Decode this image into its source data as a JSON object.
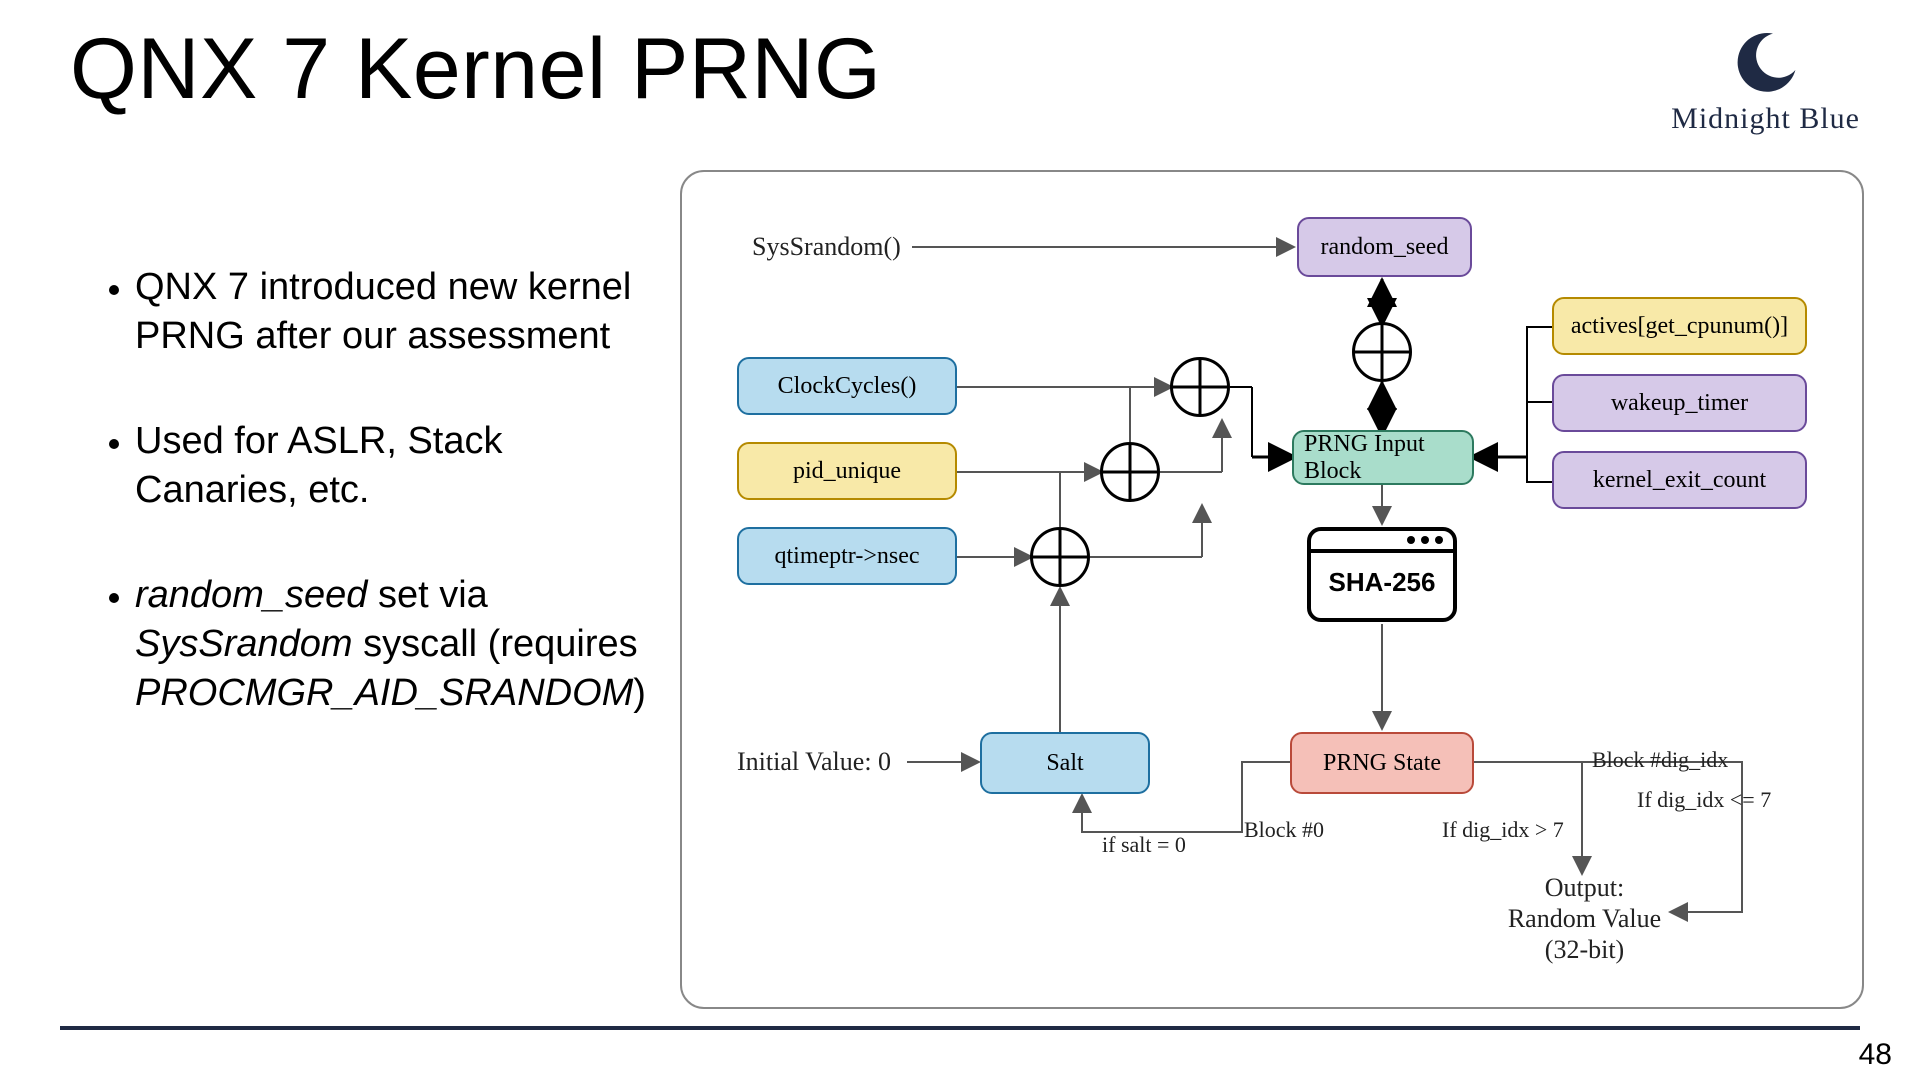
{
  "title": "QNX 7 Kernel PRNG",
  "logo_text": "Midnight Blue",
  "page_number": "48",
  "bullets": {
    "b1": "QNX 7 introduced new kernel PRNG after our assessment",
    "b2": "Used for ASLR, Stack Canaries, etc.",
    "b3_pre": "",
    "b3_rs": "random_seed",
    "b3_mid": " set via ",
    "b3_sys": "SysSrandom",
    "b3_post": " syscall (requires ",
    "b3_priv": "PROCMGR_AID_SRANDOM",
    "b3_end": ")"
  },
  "diagram": {
    "syssrandom": "SysSrandom()",
    "random_seed": "random_seed",
    "clockcycles": "ClockCycles()",
    "pid_unique": "pid_unique",
    "qtimeptr": "qtimeptr->nsec",
    "initial_value": "Initial Value: 0",
    "salt": "Salt",
    "prng_input": "PRNG Input Block",
    "sha": "SHA-256",
    "prng_state": "PRNG State",
    "actives": "actives[get_cpunum()]",
    "wakeup": "wakeup_timer",
    "kexit": "kernel_exit_count",
    "if_salt0": "if salt = 0",
    "block0": "Block #0",
    "dig_gt7": "If dig_idx > 7",
    "block_dig": "Block #dig_idx",
    "dig_le7": "If dig_idx <= 7",
    "output1": "Output:",
    "output2": "Random Value",
    "output3": "(32-bit)"
  }
}
